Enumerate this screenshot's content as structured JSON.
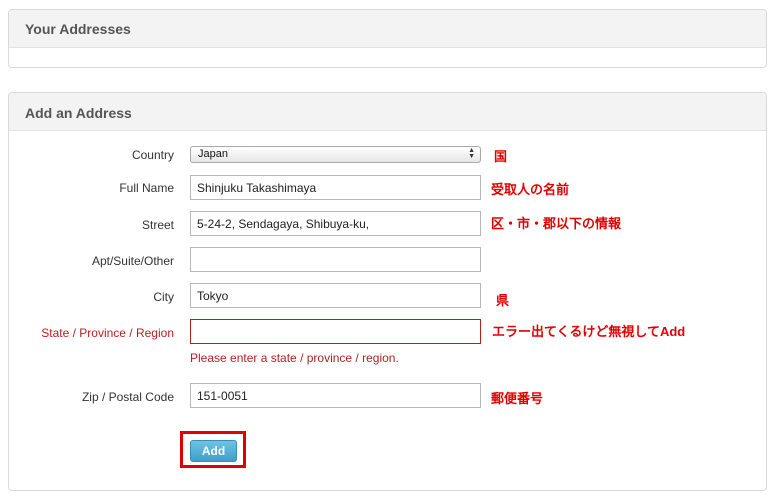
{
  "addresses_panel": {
    "title": "Your Addresses"
  },
  "add_panel": {
    "title": "Add an Address"
  },
  "form": {
    "country": {
      "label": "Country",
      "value": "Japan"
    },
    "full_name": {
      "label": "Full Name",
      "value": "Shinjuku Takashimaya"
    },
    "street": {
      "label": "Street",
      "value": "5-24-2, Sendagaya, Shibuya-ku,"
    },
    "apt": {
      "label": "Apt/Suite/Other",
      "value": ""
    },
    "city": {
      "label": "City",
      "value": "Tokyo"
    },
    "state": {
      "label": "State / Province / Region",
      "value": "",
      "error": "Please enter a state / province / region."
    },
    "zip": {
      "label": "Zip / Postal Code",
      "value": "151-0051"
    },
    "submit_label": "Add"
  },
  "annotations": {
    "country": "国",
    "full_name": "受取人の名前",
    "street": "区・市・郡以下の情報",
    "city": "県",
    "state": "エラー出てくるけど無視してAdd",
    "zip": "郵便番号"
  },
  "colors": {
    "annotation": "#e00000",
    "error": "#b22222",
    "button": "#4aaed6"
  }
}
